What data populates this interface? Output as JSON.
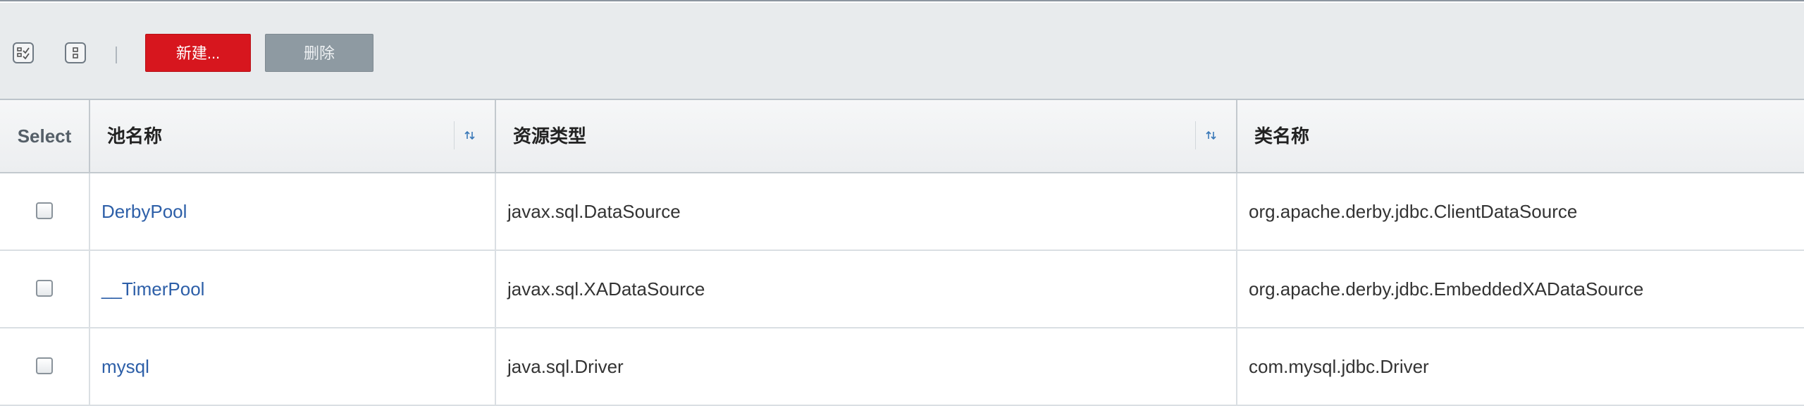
{
  "toolbar": {
    "select_all_icon": "select-all-icon",
    "deselect_all_icon": "deselect-all-icon",
    "new_label": "新建...",
    "delete_label": "删除",
    "colors": {
      "new": "#d7161e",
      "delete": "#8e9aa2"
    }
  },
  "table": {
    "headers": {
      "select": "Select",
      "pool_name": "池名称",
      "resource_type": "资源类型",
      "class_name": "类名称"
    },
    "sort_icon": "sort-arrows-icon",
    "rows": [
      {
        "pool_name": "DerbyPool",
        "resource_type": "javax.sql.DataSource",
        "class_name": "org.apache.derby.jdbc.ClientDataSource",
        "selected": false
      },
      {
        "pool_name": "__TimerPool",
        "resource_type": "javax.sql.XADataSource",
        "class_name": "org.apache.derby.jdbc.EmbeddedXADataSource",
        "selected": false
      },
      {
        "pool_name": "mysql",
        "resource_type": "java.sql.Driver",
        "class_name": "com.mysql.jdbc.Driver",
        "selected": false
      }
    ]
  }
}
